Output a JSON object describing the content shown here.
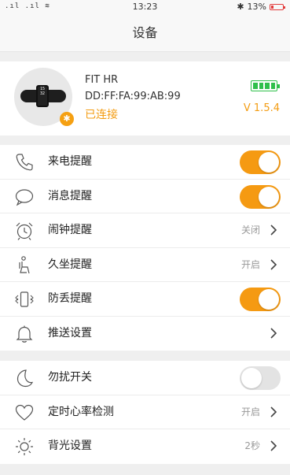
{
  "status_bar": {
    "time": "13:23",
    "battery_percent": "13%",
    "signal": "Hill"
  },
  "nav": {
    "title": "设备"
  },
  "device": {
    "name": "FIT HR",
    "mac": "DD:FF:FA:99:AB:99",
    "status": "已连接",
    "version": "V 1.5.4",
    "battery_level": 1.0,
    "watch_time": "15",
    "watch_sub": "32"
  },
  "group1": [
    {
      "label": "来电提醒",
      "icon": "phone-icon",
      "control": "toggle",
      "on": true
    },
    {
      "label": "消息提醒",
      "icon": "message-icon",
      "control": "toggle",
      "on": true
    },
    {
      "label": "闹钟提醒",
      "icon": "alarm-clock-icon",
      "control": "link",
      "value": "关闭"
    },
    {
      "label": "久坐提醒",
      "icon": "sedentary-icon",
      "control": "link",
      "value": "开启"
    },
    {
      "label": "防丢提醒",
      "icon": "anti-lost-icon",
      "control": "toggle",
      "on": true
    },
    {
      "label": "推送设置",
      "icon": "bell-icon",
      "control": "link",
      "value": ""
    }
  ],
  "group2": [
    {
      "label": "勿扰开关",
      "icon": "moon-icon",
      "control": "toggle",
      "on": false
    },
    {
      "label": "定时心率检测",
      "icon": "heart-icon",
      "control": "link",
      "value": "开启"
    },
    {
      "label": "背光设置",
      "icon": "sun-icon",
      "control": "link",
      "value": "2秒"
    }
  ],
  "colors": {
    "accent": "#f59a12",
    "connected": "#f39c12",
    "battery": "#2fbf4b"
  }
}
